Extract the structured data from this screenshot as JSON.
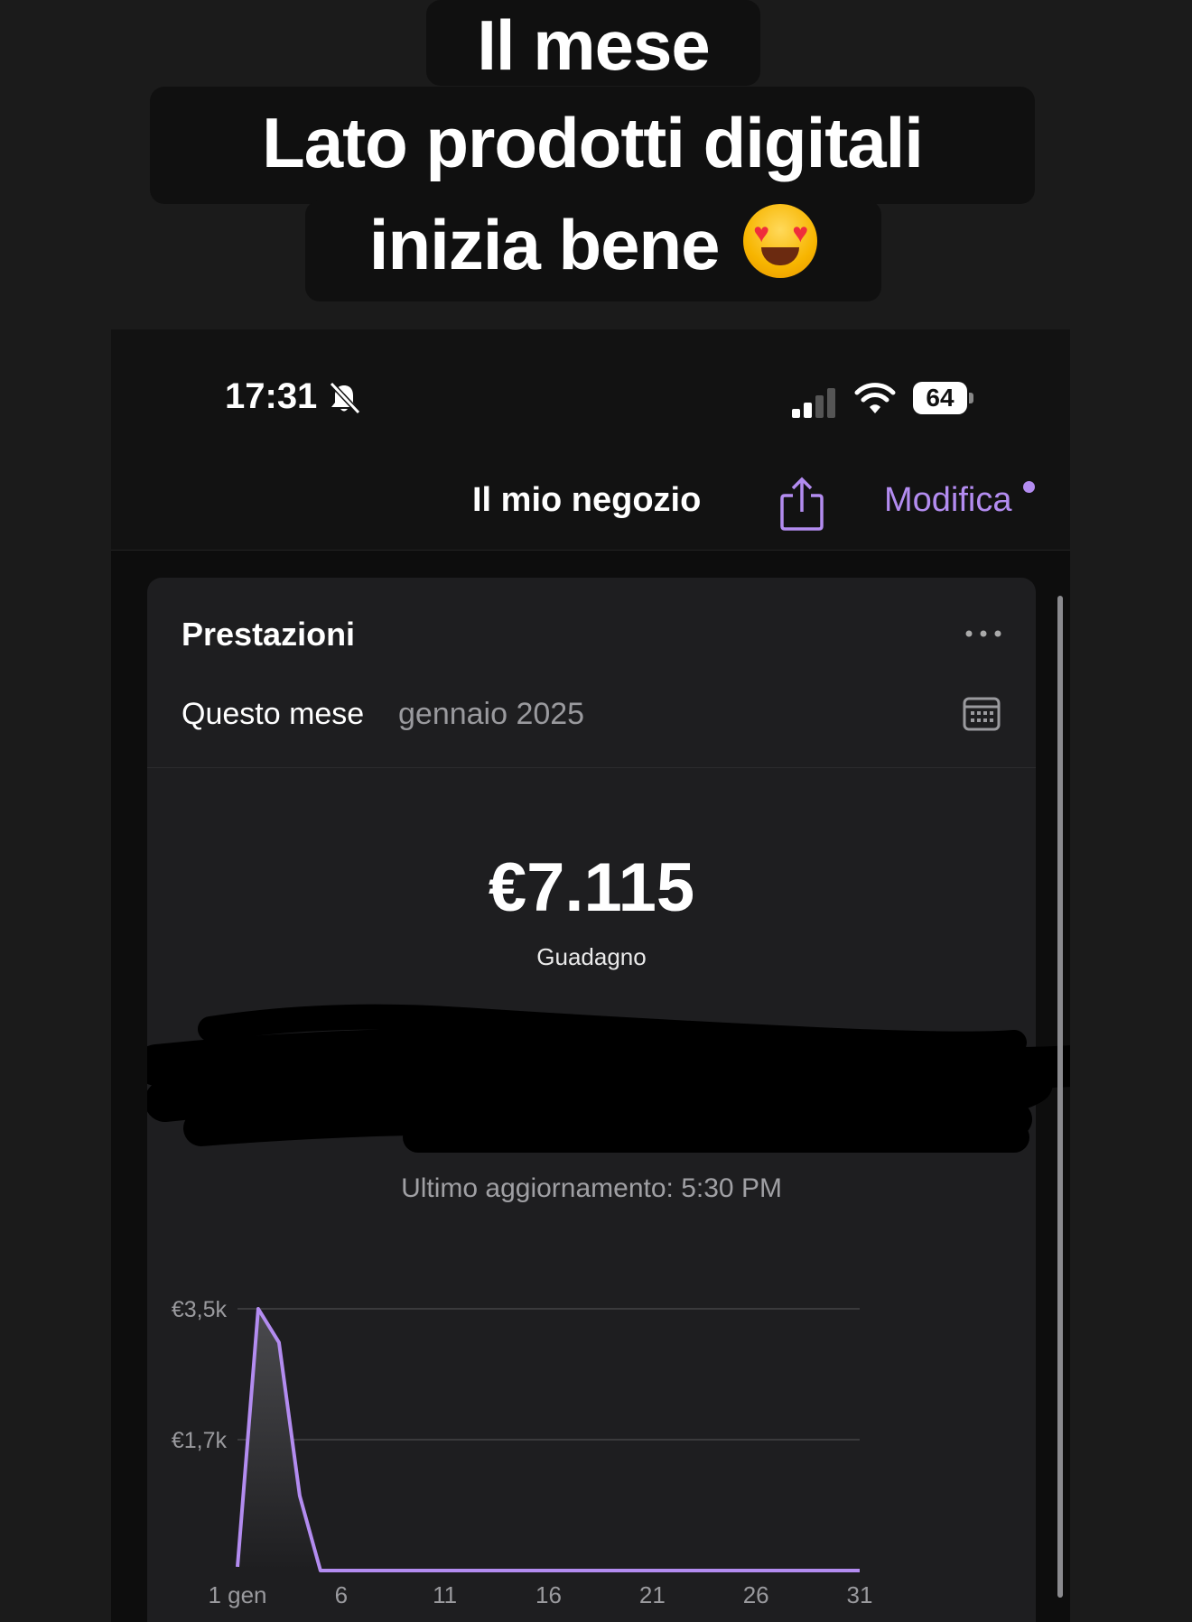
{
  "caption": {
    "line1": "Il mese",
    "line2": "Lato prodotti digitali",
    "line3": "inizia bene",
    "emoji": "heart-eyes-emoji"
  },
  "status_bar": {
    "time": "17:31",
    "battery": "64",
    "icons": [
      "bell-slash-icon",
      "signal-icon",
      "wifi-icon",
      "battery-icon"
    ]
  },
  "nav": {
    "title": "Il mio negozio",
    "share_icon": "share-icon",
    "edit_label": "Modifica",
    "accent": "#b38cf0"
  },
  "card": {
    "title": "Prestazioni",
    "more_icon": "ellipsis-icon",
    "period_label": "Questo mese",
    "period_value": "gennaio 2025",
    "calendar_icon": "calendar-icon",
    "amount": "€7.115",
    "amount_label": "Guadagno",
    "updated": "Ultimo aggiornamento: 5:30 PM"
  },
  "chart_data": {
    "type": "area",
    "x": [
      1,
      2,
      3,
      4,
      5,
      6,
      7,
      8,
      9,
      10,
      11,
      12,
      13,
      14,
      15,
      16,
      17,
      18,
      19,
      20,
      21,
      22,
      23,
      24,
      25,
      26,
      27,
      28,
      29,
      30,
      31
    ],
    "values": [
      50,
      3500,
      3050,
      1000,
      0,
      0,
      0,
      0,
      0,
      0,
      0,
      0,
      0,
      0,
      0,
      0,
      0,
      0,
      0,
      0,
      0,
      0,
      0,
      0,
      0,
      0,
      0,
      0,
      0,
      0,
      0
    ],
    "x_tick_labels": [
      "1 gen",
      "6",
      "11",
      "16",
      "21",
      "26",
      "31"
    ],
    "x_tick_values": [
      1,
      6,
      11,
      16,
      21,
      26,
      31
    ],
    "y_tick_labels": [
      "€3,5k",
      "€1,7k"
    ],
    "y_tick_values": [
      3500,
      1750
    ],
    "ylim": [
      0,
      3500
    ],
    "xlim": [
      1,
      31
    ],
    "grid": true,
    "line_color": "#b38cf0"
  }
}
